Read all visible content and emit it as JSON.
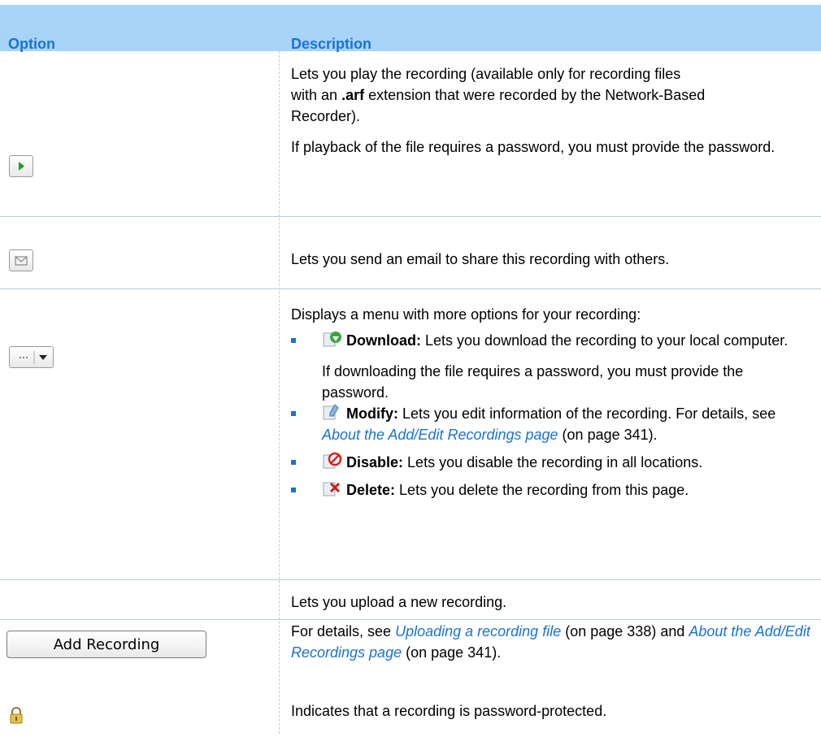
{
  "headers": {
    "option": "Option",
    "description": "Description"
  },
  "rows": {
    "play": {
      "icon": "play-icon",
      "line1": "Lets you play the recording (available only for recording files",
      "line2_pre": "with an",
      "line2_ext": ".arf",
      "line2_post": "extension that were recorded by the Network-Based",
      "line3": "Recorder).",
      "para2": "If playback of the file requires a password, you must provide the password."
    },
    "email": {
      "icon": "envelope-icon",
      "text": "Lets you send an email to share this recording with others."
    },
    "more": {
      "icon": "more-options-dropdown-icon",
      "intro": "Displays a menu with more options for your recording:",
      "download_label": "Download:",
      "download_text": "Lets you download the recording to your local computer.",
      "download_note": "If downloading the file requires a password, you must provide the password.",
      "modify_label": "Modify:",
      "modify_text": "Lets you edit information of the recording. For details, see",
      "modify_link": "About the Add/Edit Recordings page",
      "modify_page": "(on page 341).",
      "disable_label": "Disable:",
      "disable_text": "Lets you disable the recording in all locations.",
      "delete_label": "Delete:",
      "delete_text": "Lets you delete the recording from this page."
    },
    "add": {
      "button_label": "Add Recording",
      "text": "Lets you upload a new recording.",
      "details_pre": "For details, see",
      "link1": "Uploading a recording file",
      "link1_page": "(on page 338) and",
      "link2": "About the Add/Edit Recordings page",
      "link2_page": "(on page 341)."
    },
    "lock": {
      "icon": "lock-icon",
      "text": "Indicates that a recording is password-protected."
    }
  }
}
